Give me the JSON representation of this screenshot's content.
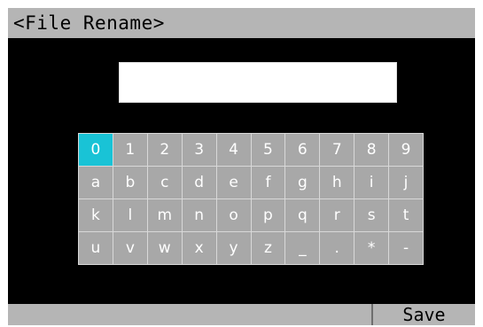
{
  "title": "<File Rename>",
  "name_field": {
    "value": ""
  },
  "keyboard": {
    "selected_key": "0",
    "keys": [
      "0",
      "1",
      "2",
      "3",
      "4",
      "5",
      "6",
      "7",
      "8",
      "9",
      "a",
      "b",
      "c",
      "d",
      "e",
      "f",
      "g",
      "h",
      "i",
      "j",
      "k",
      "l",
      "m",
      "n",
      "o",
      "p",
      "q",
      "r",
      "s",
      "t",
      "u",
      "v",
      "w",
      "x",
      "y",
      "z",
      "_",
      ".",
      "*",
      "-"
    ]
  },
  "bottom": {
    "save_label": "Save"
  },
  "colors": {
    "screen": "#000000",
    "bars": "#b5b5b5",
    "key": "#a8a8a8",
    "key_selected": "#19c3d6",
    "key_text": "#ffffff"
  }
}
